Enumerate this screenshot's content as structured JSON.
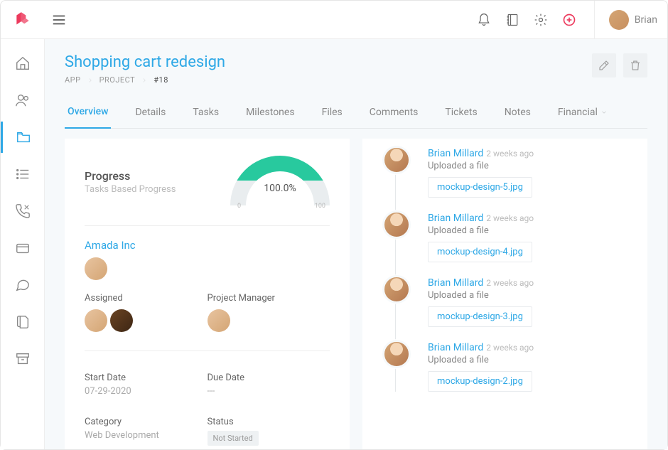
{
  "topbar": {
    "user_name": "Brian"
  },
  "page": {
    "title": "Shopping cart redesign",
    "breadcrumb": {
      "p1": "APP",
      "p2": "PROJECT",
      "p3": "#18"
    }
  },
  "tabs": {
    "overview": "Overview",
    "details": "Details",
    "tasks": "Tasks",
    "milestones": "Milestones",
    "files": "Files",
    "comments": "Comments",
    "tickets": "Tickets",
    "notes": "Notes",
    "financial": "Financial"
  },
  "overview": {
    "progress_label": "Progress",
    "progress_sub": "Tasks Based Progress",
    "progress_pct": "100.0%",
    "gauge_min": "0",
    "gauge_max": "100",
    "client_name": "Amada Inc",
    "assigned_label": "Assigned",
    "pm_label": "Project Manager",
    "start_date_label": "Start Date",
    "start_date": "07-29-2020",
    "due_date_label": "Due Date",
    "due_date": "---",
    "category_label": "Category",
    "category": "Web Development",
    "status_label": "Status",
    "status": "Not Started"
  },
  "activity": [
    {
      "name": "Brian Millard",
      "time": "2 weeks ago",
      "desc": "Uploaded a file",
      "file": "mockup-design-5.jpg"
    },
    {
      "name": "Brian Millard",
      "time": "2 weeks ago",
      "desc": "Uploaded a file",
      "file": "mockup-design-4.jpg"
    },
    {
      "name": "Brian Millard",
      "time": "2 weeks ago",
      "desc": "Uploaded a file",
      "file": "mockup-design-3.jpg"
    },
    {
      "name": "Brian Millard",
      "time": "2 weeks ago",
      "desc": "Uploaded a file",
      "file": "mockup-design-2.jpg"
    }
  ]
}
